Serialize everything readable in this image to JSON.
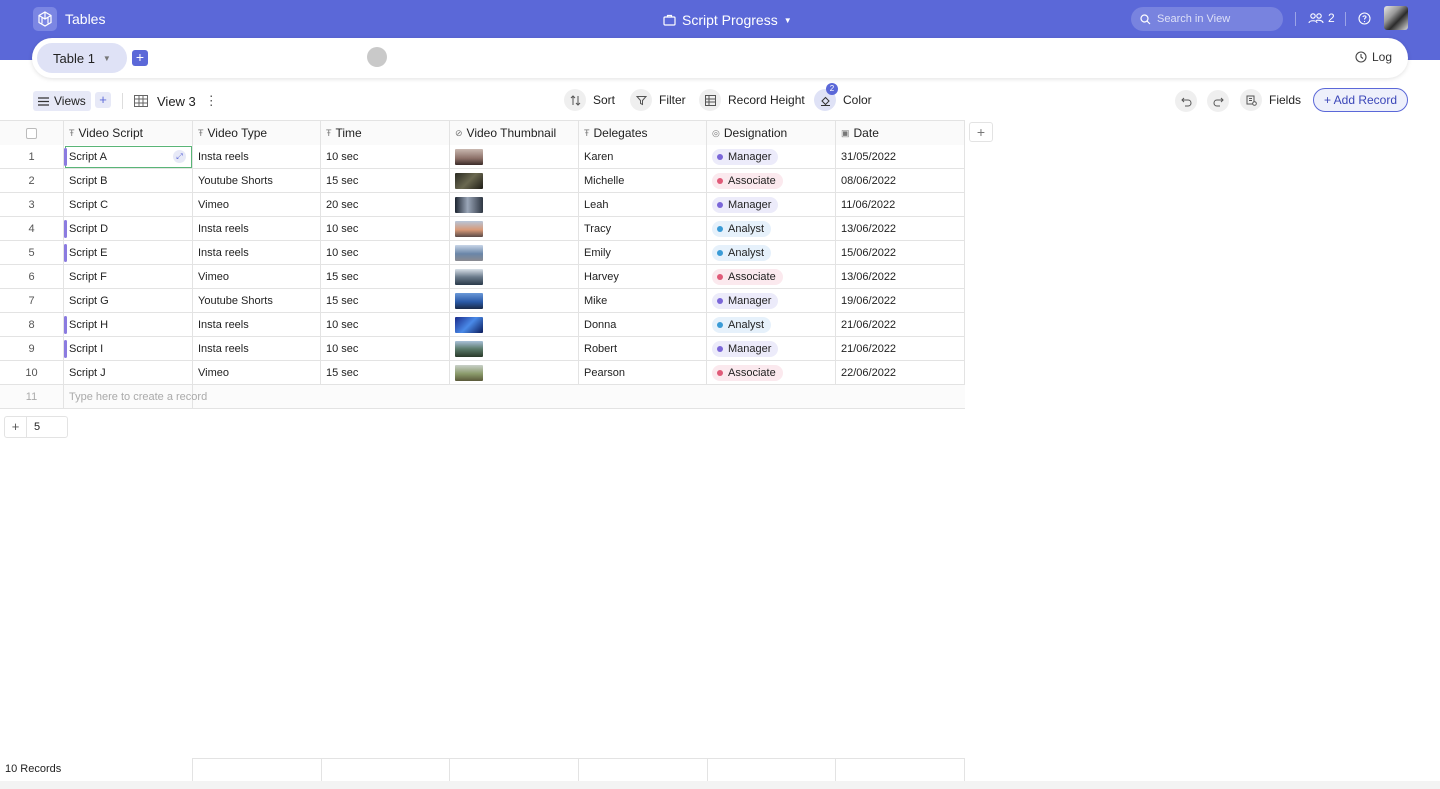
{
  "app": {
    "title": "Tables"
  },
  "document": {
    "title": "Script Progress"
  },
  "search": {
    "placeholder": "Search in View"
  },
  "collaborators": {
    "count": "2"
  },
  "tabs": {
    "active": "Table 1",
    "add_label": "+"
  },
  "log": {
    "label": "Log"
  },
  "toolbar": {
    "views_label": "Views",
    "add_view_label": "+",
    "view_name": "View 3",
    "sort_label": "Sort",
    "filter_label": "Filter",
    "record_height_label": "Record Height",
    "color_label": "Color",
    "color_badge": "2",
    "fields_label": "Fields",
    "add_record_label": "+ Add Record"
  },
  "colors": {
    "accent": "#5b68d8",
    "row_marker": "#8b7be0",
    "manager": "#7a66d8",
    "associate": "#e05a78",
    "analyst": "#3a9bd6"
  },
  "columns": [
    "Video Script",
    "Video Type",
    "Time",
    "Video Thumbnail",
    "Delegates",
    "Designation",
    "Date"
  ],
  "rows": [
    {
      "num": "1",
      "script": "Script A",
      "type": "Insta reels",
      "time": "10 sec",
      "delegate": "Karen",
      "designation": "Manager",
      "date": "31/05/2022"
    },
    {
      "num": "2",
      "script": "Script B",
      "type": "Youtube Shorts",
      "time": "15 sec",
      "delegate": "Michelle",
      "designation": "Associate",
      "date": "08/06/2022"
    },
    {
      "num": "3",
      "script": "Script C",
      "type": "Vimeo",
      "time": "20 sec",
      "delegate": "Leah",
      "designation": "Manager",
      "date": "11/06/2022"
    },
    {
      "num": "4",
      "script": "Script D",
      "type": "Insta reels",
      "time": "10 sec",
      "delegate": "Tracy",
      "designation": "Analyst",
      "date": "13/06/2022"
    },
    {
      "num": "5",
      "script": "Script E",
      "type": "Insta reels",
      "time": "10 sec",
      "delegate": "Emily",
      "designation": "Analyst",
      "date": "15/06/2022"
    },
    {
      "num": "6",
      "script": "Script F",
      "type": "Vimeo",
      "time": "15 sec",
      "delegate": "Harvey",
      "designation": "Associate",
      "date": "13/06/2022"
    },
    {
      "num": "7",
      "script": "Script G",
      "type": "Youtube Shorts",
      "time": "15 sec",
      "delegate": "Mike",
      "designation": "Manager",
      "date": "19/06/2022"
    },
    {
      "num": "8",
      "script": "Script H",
      "type": "Insta reels",
      "time": "10 sec",
      "delegate": "Donna",
      "designation": "Analyst",
      "date": "21/06/2022"
    },
    {
      "num": "9",
      "script": "Script I",
      "type": "Insta reels",
      "time": "10 sec",
      "delegate": "Robert",
      "designation": "Manager",
      "date": "21/06/2022"
    },
    {
      "num": "10",
      "script": "Script J",
      "type": "Vimeo",
      "time": "15 sec",
      "delegate": "Pearson",
      "designation": "Associate",
      "date": "22/06/2022"
    }
  ],
  "new_row": {
    "num": "11",
    "placeholder": "Type here to create a record"
  },
  "group": {
    "plus": "+",
    "count": "5"
  },
  "footer": {
    "records": "10 Records"
  }
}
